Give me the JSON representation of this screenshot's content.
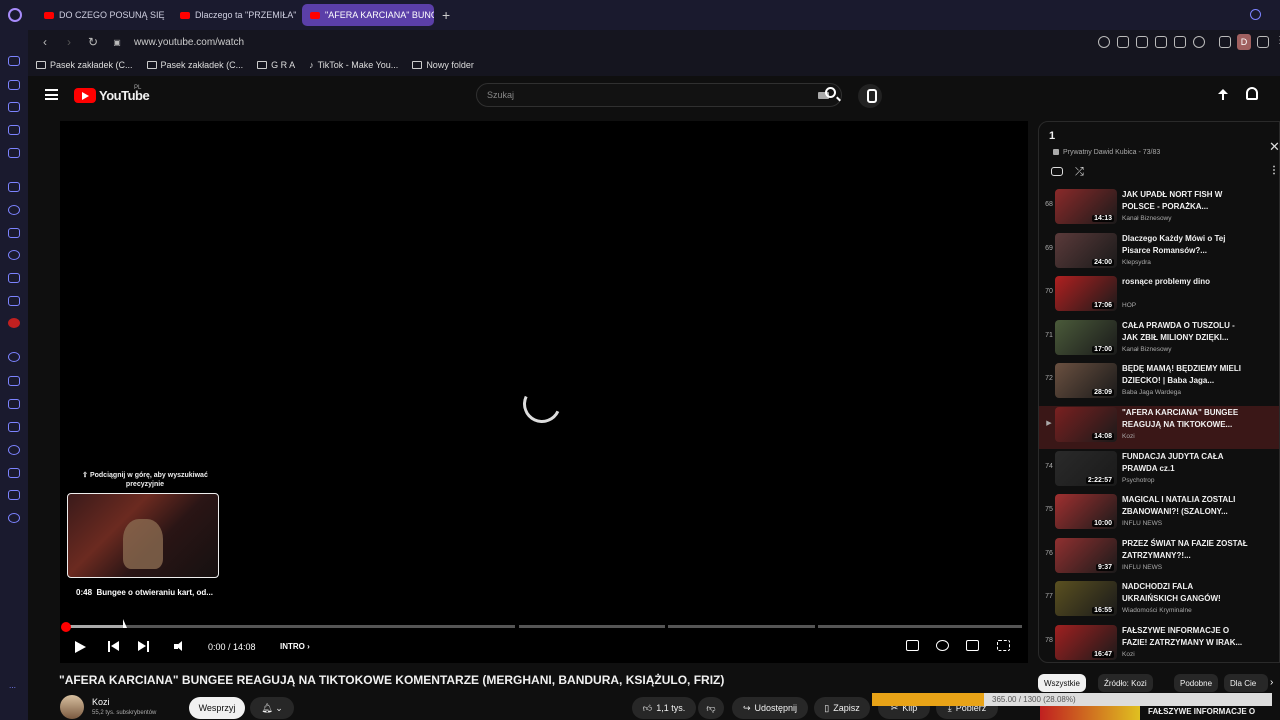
{
  "browser": {
    "tabs": [
      {
        "label": "DO CZEGO POSUNĄ SIĘ K",
        "active": false
      },
      {
        "label": "Dlaczego ta \"PRZEMIŁA\"",
        "active": false
      },
      {
        "label": "\"AFERA KARCIANA\" BUNG",
        "active": true
      }
    ],
    "url": "www.youtube.com/watch",
    "bookmarks": [
      {
        "label": "Pasek zakładek (C...",
        "icon": "folder-icon"
      },
      {
        "label": "Pasek zakładek (C...",
        "icon": "folder-icon"
      },
      {
        "label": "G R A",
        "icon": "folder-icon"
      },
      {
        "label": "TikTok - Make You...",
        "icon": "tiktok-icon"
      },
      {
        "label": "Nowy folder",
        "icon": "folder-icon"
      }
    ],
    "profile_letter": "D"
  },
  "youtube": {
    "logo_text": "YouTube",
    "region": "PL",
    "search_placeholder": "Szukaj"
  },
  "player": {
    "seek_hint": "⇧ Podciągnij w górę, aby wyszukiwać precyzyjnie",
    "preview_time": "0:48",
    "preview_label": "Bungee o otwieraniu kart, od...",
    "time": "0:00 / 14:08",
    "chapter": "INTRO",
    "progress_fraction": 0.0
  },
  "video": {
    "title": "\"AFERA KARCIANA\" BUNGEE REAGUJĄ NA TIKTOKOWE KOMENTARZE (MERGHANI, BANDURA, KSIĄŻULO, FRIZ)",
    "channel": "Kozi",
    "subscribers": "55,2 tys. subskrybentów",
    "support_label": "Wesprzyj",
    "likes": "1,1 tys.",
    "share_label": "Udostępnij",
    "save_label": "Zapisz",
    "clip_label": "Klip",
    "download_label": "Pobierz"
  },
  "playlist": {
    "title": "1",
    "owner": "Prywatny  Dawid Kubica - 73/83",
    "items": [
      {
        "index": "68",
        "title": "JAK UPADŁ NORT FISH W POLSCE - PORAŻKA...",
        "channel": "Kanał Biznesowy",
        "duration": "14:13",
        "color": "#8a2a2a",
        "active": false
      },
      {
        "index": "69",
        "title": "Dlaczego Każdy Mówi o Tej Pisarce Romansów?...",
        "channel": "Klepsydra",
        "duration": "24:00",
        "color": "#5a3a3a",
        "active": false
      },
      {
        "index": "70",
        "title": "rosnące problemy dino",
        "channel": "HOP",
        "duration": "17:06",
        "color": "#b02020",
        "active": false
      },
      {
        "index": "71",
        "title": "CAŁA PRAWDA O TUSZOLU - JAK ZBIŁ MILIONY DZIĘKI...",
        "channel": "Kanał Biznesowy",
        "duration": "17:00",
        "color": "#4a5a3a",
        "active": false
      },
      {
        "index": "72",
        "title": "BĘDĘ MAMĄ! BĘDZIEMY MIELI DZIECKO! | Baba Jaga...",
        "channel": "Baba Jaga Wardega",
        "duration": "28:09",
        "color": "#6a5040",
        "active": false
      },
      {
        "index": "▶",
        "title": "\"AFERA KARCIANA\" BUNGEE REAGUJĄ NA TIKTOKOWE...",
        "channel": "Kozi",
        "duration": "14:08",
        "color": "#7a2020",
        "active": true
      },
      {
        "index": "74",
        "title": "FUNDACJA JUDYTA CAŁA PRAWDA cz.1",
        "channel": "Psychotrop",
        "duration": "2:22:57",
        "color": "#2a2a2a",
        "active": false
      },
      {
        "index": "75",
        "title": "MAGICAL I NATALIA ZOSTALI ZBANOWANI?! (SZALONY...",
        "channel": "INFLU NEWS",
        "duration": "10:00",
        "color": "#a03030",
        "active": false
      },
      {
        "index": "76",
        "title": "PRZEZ ŚWIAT NA FAZIE ZOSTAŁ ZATRZYMANY?!...",
        "channel": "INFLU NEWS",
        "duration": "9:37",
        "color": "#903030",
        "active": false
      },
      {
        "index": "77",
        "title": "NADCHODZI FALA UKRAIŃSKICH GANGÓW!",
        "channel": "Wiadomości Kryminalne",
        "duration": "16:55",
        "color": "#5a5020",
        "active": false
      },
      {
        "index": "78",
        "title": "FAŁSZYWE INFORMACJE O FAZIE! ZATRZYMANY W IRAK...",
        "channel": "Kozi",
        "duration": "16:47",
        "color": "#a02020",
        "active": false
      }
    ]
  },
  "filters": [
    "Wszystkie",
    "Źródło: Kozi",
    "Podobne",
    "Dla Cie"
  ],
  "next_title": "FAŁSZYWE INFORMACJE O",
  "download": {
    "text": "365.00 / 1300 (28.08%)",
    "fraction": 0.2808
  }
}
